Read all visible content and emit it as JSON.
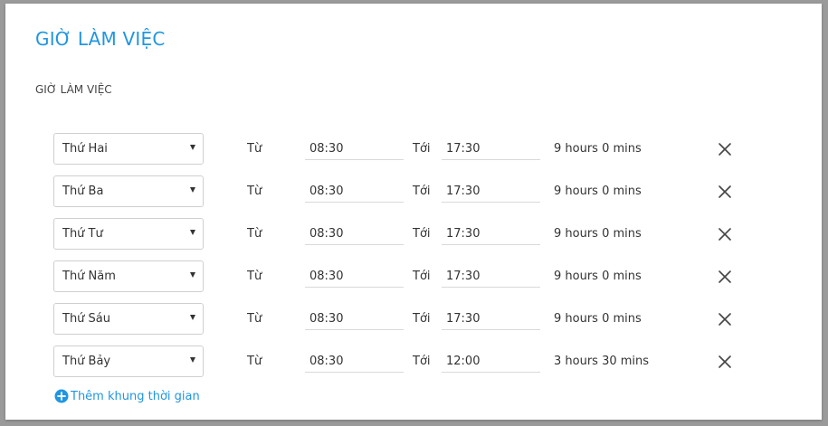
{
  "page": {
    "title": "GIỜ LÀM VIỆC",
    "section_label": "GIỜ LÀM VIỆC"
  },
  "colors": {
    "accent": "#2196e0",
    "text": "#333333",
    "border": "#cfcfcf"
  },
  "schedule": {
    "from_label": "Từ",
    "to_label": "Tới",
    "rows": [
      {
        "day": "Thứ Hai",
        "start": "08:30",
        "end": "17:30",
        "duration": "9 hours 0 mins"
      },
      {
        "day": "Thứ Ba",
        "start": "08:30",
        "end": "17:30",
        "duration": "9 hours 0 mins"
      },
      {
        "day": "Thứ Tư",
        "start": "08:30",
        "end": "17:30",
        "duration": "9 hours 0 mins"
      },
      {
        "day": "Thứ Năm",
        "start": "08:30",
        "end": "17:30",
        "duration": "9 hours 0 mins"
      },
      {
        "day": "Thứ Sáu",
        "start": "08:30",
        "end": "17:30",
        "duration": "9 hours 0 mins"
      },
      {
        "day": "Thứ Bảy",
        "start": "08:30",
        "end": "12:00",
        "duration": "3 hours 30 mins"
      }
    ]
  },
  "add_slot": {
    "label": "Thêm khung thời gian",
    "icon": "plus-circle-icon"
  },
  "icons": {
    "remove": "close-icon",
    "dropdown": "chevron-down-icon"
  }
}
